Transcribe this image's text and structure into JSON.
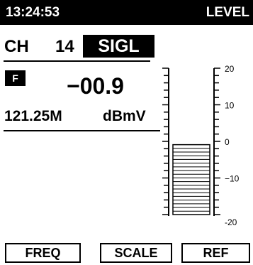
{
  "status_bar": {
    "time": "13:24:53",
    "mode": "LEVEL"
  },
  "channel": {
    "prefix": "CH",
    "number": "14",
    "type": "SIGL"
  },
  "flag": "F",
  "reading": {
    "value": "−00.9",
    "frequency": "121.25M",
    "unit": "dBmV"
  },
  "meter": {
    "scale_labels": [
      "20",
      "10",
      "0",
      "−10",
      "-20"
    ],
    "range": [
      -20,
      20
    ],
    "level": -0.9
  },
  "softkeys": {
    "freq": "FREQ",
    "scale": "SCALE",
    "ref": "REF"
  }
}
